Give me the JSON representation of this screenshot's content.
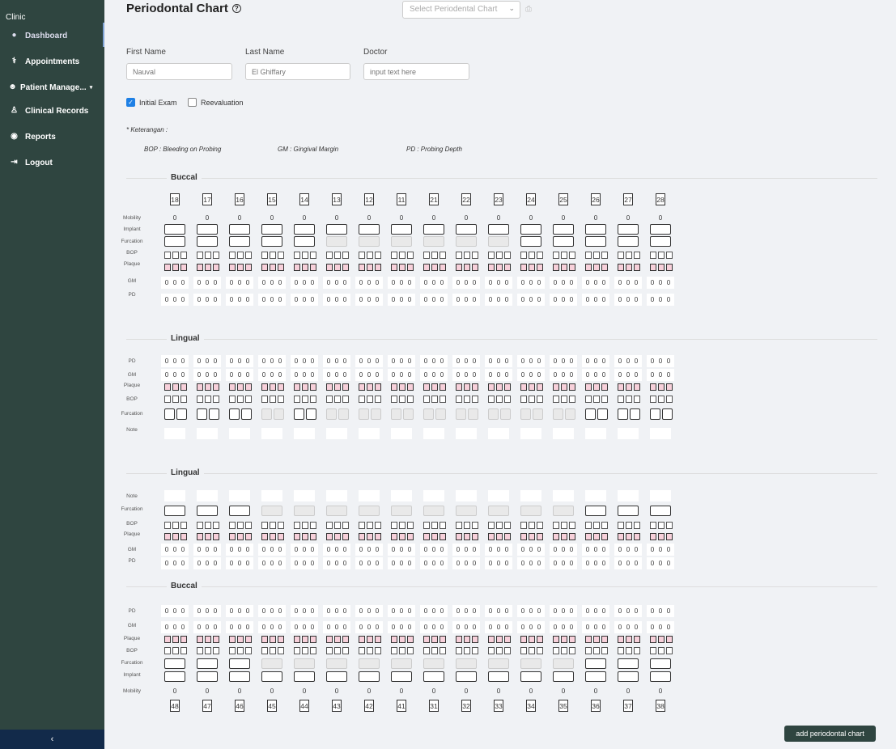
{
  "sidebar": {
    "brand": "Clinic",
    "items": [
      {
        "label": "Dashboard",
        "icon": "palette-icon"
      },
      {
        "label": "Appointments",
        "icon": "stethoscope-icon"
      },
      {
        "label": "Patient Manage...",
        "icon": "smiley-icon"
      },
      {
        "label": "Clinical Records",
        "icon": "doctor-icon"
      },
      {
        "label": "Reports",
        "icon": "eye-icon"
      },
      {
        "label": "Logout",
        "icon": "logout-icon"
      }
    ],
    "collapse_label": "‹"
  },
  "header": {
    "title": "Periodontal Chart",
    "select_placeholder": "Select Periodental Chart"
  },
  "form": {
    "first_name": {
      "label": "First Name",
      "placeholder": "Nauval"
    },
    "last_name": {
      "label": "Last Name",
      "placeholder": "El Ghiffary"
    },
    "doctor": {
      "label": "Doctor",
      "placeholder": "input text here"
    },
    "initial_exam": {
      "label": "Initial Exam",
      "checked": true
    },
    "reevaluation": {
      "label": "Reevaluation",
      "checked": false
    }
  },
  "legend": {
    "title": "* Keterangan :",
    "items": [
      "BOP : Bleeding on Probing",
      "GM : Gingival Margin",
      "PD : Probing Depth"
    ]
  },
  "upper_teeth": [
    "18",
    "17",
    "16",
    "15",
    "14",
    "13",
    "12",
    "11",
    "21",
    "22",
    "23",
    "24",
    "25",
    "26",
    "27",
    "28"
  ],
  "lower_teeth": [
    "48",
    "47",
    "46",
    "45",
    "44",
    "43",
    "42",
    "41",
    "31",
    "32",
    "33",
    "34",
    "35",
    "36",
    "37",
    "38"
  ],
  "sections": {
    "upper_buccal": {
      "title": "Buccal",
      "rows": [
        "Mobility",
        "Implant",
        "Furcation",
        "BOP",
        "Plaque",
        "GM",
        "PD"
      ]
    },
    "upper_lingual": {
      "title": "Lingual",
      "rows": [
        "PD",
        "GM",
        "Plaque",
        "BOP",
        "Furcation",
        "Note"
      ]
    },
    "lower_lingual": {
      "title": "Lingual",
      "rows": [
        "Note",
        "Furcation",
        "BOP",
        "Plaque",
        "GM",
        "PD"
      ]
    },
    "lower_buccal": {
      "title": "Buccal",
      "rows": [
        "PD",
        "GM",
        "Plaque",
        "BOP",
        "Furcation",
        "Implant",
        "Mobility"
      ]
    }
  },
  "default_value": "0",
  "furcation_disabled_upper_buccal": [
    5,
    6,
    7,
    8,
    9,
    10
  ],
  "furcation_disabled_upper_lingual": [
    3,
    5,
    6,
    7,
    8,
    9,
    10,
    11,
    12
  ],
  "furcation_disabled_lower_lingual": [
    3,
    4,
    5,
    6,
    7,
    8,
    9,
    10,
    11,
    12
  ],
  "furcation_disabled_lower_buccal": [
    3,
    4,
    5,
    6,
    7,
    8,
    9,
    10,
    11,
    12
  ],
  "colors": {
    "sidebar": "#2f4540",
    "plaque": "#f7d0da",
    "accent": "#1e80e5",
    "collapse_bar": "#122a4a"
  },
  "actions": {
    "add_label": "add periodontal chart"
  }
}
